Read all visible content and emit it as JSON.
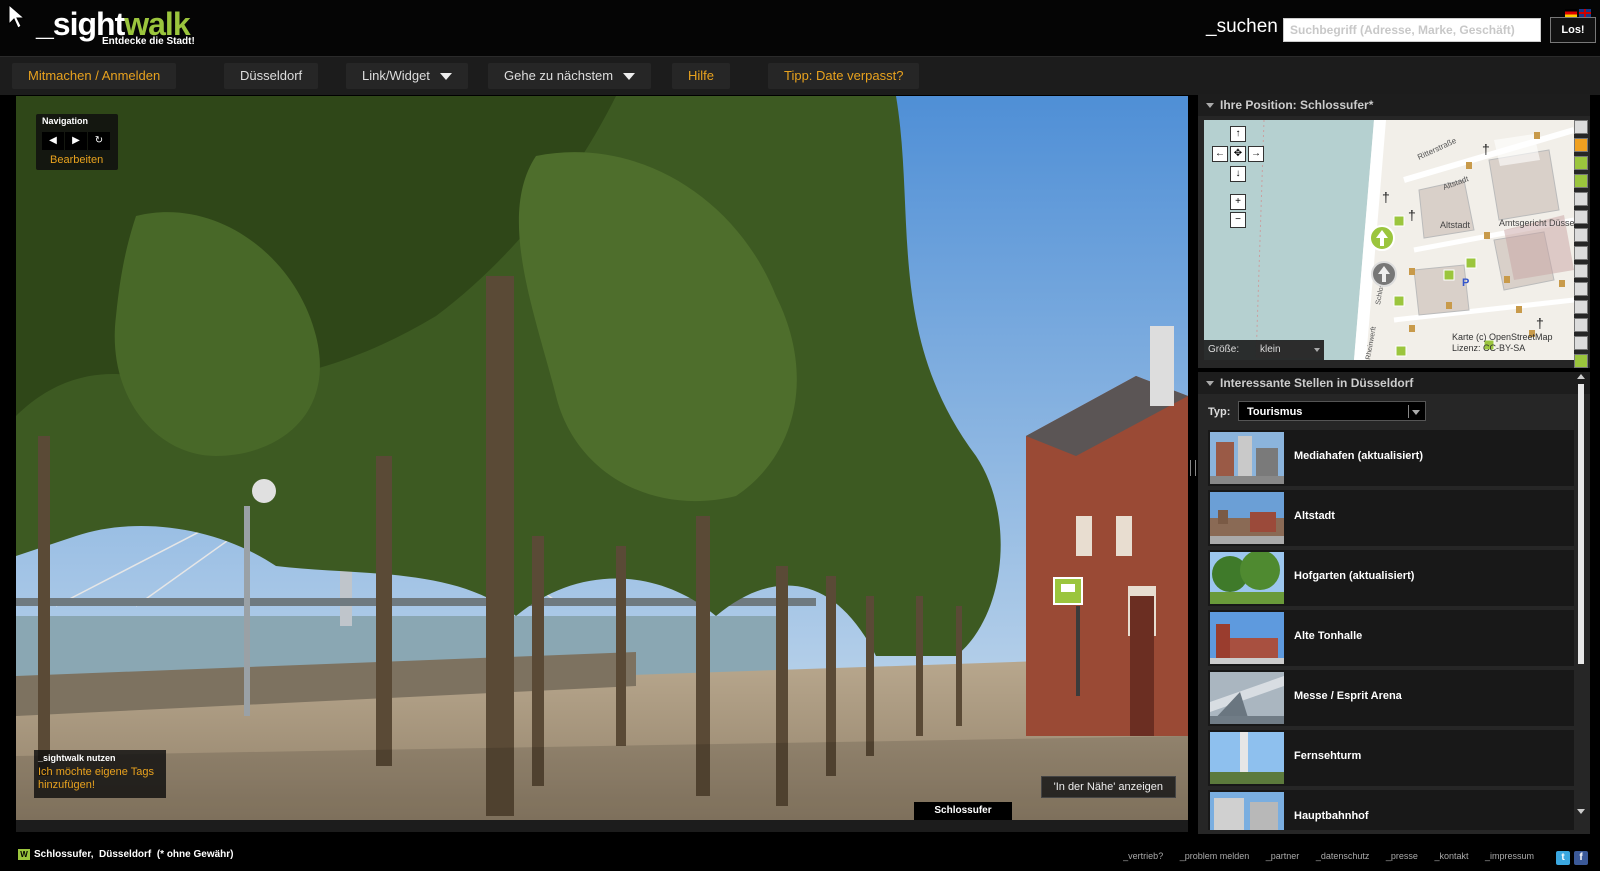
{
  "header": {
    "logo_main": "_sight",
    "logo_accent": "walk",
    "tagline": "Entdecke die Stadt!",
    "search_label": "_suchen",
    "search_placeholder": "Suchbegriff (Adresse, Marke, Geschäft)",
    "search_button": "Los!"
  },
  "nav": {
    "items": [
      {
        "label": "Mitmachen / Anmelden"
      },
      {
        "label": "Düsseldorf"
      },
      {
        "label": "Link/Widget"
      },
      {
        "label": "Gehe zu nächstem"
      },
      {
        "label": "Hilfe"
      },
      {
        "label": "Tipp: Date verpasst?"
      }
    ]
  },
  "pano": {
    "nav_title": "Navigation",
    "edit_label": "Bearbeiten",
    "tag_title": "_sightwalk nutzen",
    "tag_link": "Ich möchte eigene Tags hinzufügen!",
    "nearby_button": "'In der Nähe' anzeigen",
    "location_label": "Schlossufer"
  },
  "map_panel": {
    "title": "Ihre Position: Schlossufer*",
    "size_label": "Größe:",
    "size_value": "klein",
    "copyright_line1": "Karte (c) OpenStreetMap",
    "copyright_line2": "Lizenz: CC-BY-SA",
    "street_labels": [
      "Ritterstraße",
      "Altstadt",
      "Altstadt",
      "Amtsgericht Düsseldorf",
      "Schlossufer",
      "Rheinwerft"
    ]
  },
  "poi_panel": {
    "title": "Interessante Stellen in Düsseldorf",
    "type_label": "Typ:",
    "type_value": "Tourismus",
    "items": [
      {
        "label": "Mediahafen (aktualisiert)"
      },
      {
        "label": "Altstadt"
      },
      {
        "label": "Hofgarten (aktualisiert)"
      },
      {
        "label": "Alte Tonhalle"
      },
      {
        "label": "Messe / Esprit Arena"
      },
      {
        "label": "Fernsehturm"
      },
      {
        "label": "Hauptbahnhof"
      }
    ]
  },
  "footer": {
    "location_street": "Schlossufer,",
    "location_city": "Düsseldorf",
    "disclaimer": "(* ohne Gewähr)",
    "links": [
      "_vertrieb?",
      "_problem melden",
      "_partner",
      "_datenschutz",
      "_presse",
      "_kontakt",
      "_impressum"
    ]
  },
  "colors": {
    "brand_green": "#9bc53d",
    "accent_orange": "#e8a21e",
    "background": "#000000"
  }
}
